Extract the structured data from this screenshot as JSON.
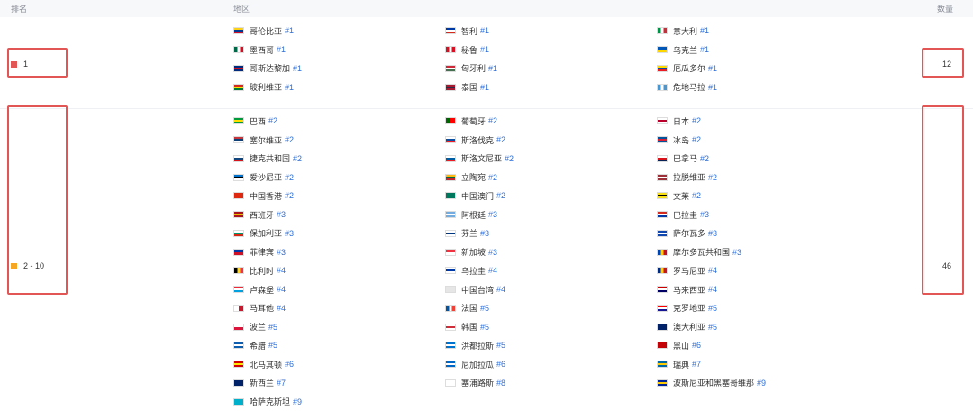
{
  "header": {
    "rank": "排名",
    "region": "地区",
    "count": "数量"
  },
  "groups": [
    {
      "rank": "1",
      "count": "12",
      "color": "#e25656",
      "regions": [
        {
          "name": "哥伦比亚",
          "num": "#1",
          "flag": [
            "#fcd116",
            "#003893",
            "#ce1126"
          ]
        },
        {
          "name": "智利",
          "num": "#1",
          "flag": [
            "#0039a6",
            "#ffffff",
            "#d52b1e"
          ]
        },
        {
          "name": "意大利",
          "num": "#1",
          "flag": [
            "#009246",
            "#ffffff",
            "#ce2b37"
          ],
          "vertical": true
        },
        {
          "name": "墨西哥",
          "num": "#1",
          "flag": [
            "#006847",
            "#ffffff",
            "#ce1126"
          ],
          "vertical": true
        },
        {
          "name": "秘鲁",
          "num": "#1",
          "flag": [
            "#d91023",
            "#ffffff",
            "#d91023"
          ],
          "vertical": true
        },
        {
          "name": "乌克兰",
          "num": "#1",
          "flag": [
            "#0057b7",
            "#ffd700"
          ]
        },
        {
          "name": "哥斯达黎加",
          "num": "#1",
          "flag": [
            "#002b7f",
            "#ce1126",
            "#002b7f"
          ]
        },
        {
          "name": "匈牙利",
          "num": "#1",
          "flag": [
            "#ce2939",
            "#ffffff",
            "#477050"
          ]
        },
        {
          "name": "厄瓜多尔",
          "num": "#1",
          "flag": [
            "#ffdd00",
            "#034ea2",
            "#ed1c24"
          ]
        },
        {
          "name": "玻利维亚",
          "num": "#1",
          "flag": [
            "#d52b1e",
            "#f9e300",
            "#007934"
          ]
        },
        {
          "name": "泰国",
          "num": "#1",
          "flag": [
            "#a51931",
            "#2d2a4a",
            "#a51931"
          ]
        },
        {
          "name": "危地马拉",
          "num": "#1",
          "flag": [
            "#4997d0",
            "#ffffff",
            "#4997d0"
          ],
          "vertical": true
        }
      ]
    },
    {
      "rank": "2 - 10",
      "count": "46",
      "color": "#f5a623",
      "regions": [
        {
          "name": "巴西",
          "num": "#2",
          "flag": [
            "#009c3b",
            "#ffdf00",
            "#009c3b"
          ]
        },
        {
          "name": "葡萄牙",
          "num": "#2",
          "flag": [
            "#006600",
            "#ff0000"
          ],
          "vertical": true
        },
        {
          "name": "日本",
          "num": "#2",
          "flag": [
            "#ffffff",
            "#bc002d",
            "#ffffff"
          ]
        },
        {
          "name": "塞尔维亚",
          "num": "#2",
          "flag": [
            "#c6363c",
            "#0c4076",
            "#ffffff"
          ]
        },
        {
          "name": "斯洛伐克",
          "num": "#2",
          "flag": [
            "#ffffff",
            "#0b4ea2",
            "#ee1c25"
          ]
        },
        {
          "name": "冰岛",
          "num": "#2",
          "flag": [
            "#02529c",
            "#dc1e35",
            "#02529c"
          ]
        },
        {
          "name": "捷克共和国",
          "num": "#2",
          "flag": [
            "#ffffff",
            "#11457e",
            "#d7141a"
          ]
        },
        {
          "name": "斯洛文尼亚",
          "num": "#2",
          "flag": [
            "#ffffff",
            "#005da4",
            "#ed1c24"
          ]
        },
        {
          "name": "巴拿马",
          "num": "#2",
          "flag": [
            "#ffffff",
            "#da121a",
            "#072357"
          ]
        },
        {
          "name": "爱沙尼亚",
          "num": "#2",
          "flag": [
            "#0072ce",
            "#000000",
            "#ffffff"
          ]
        },
        {
          "name": "立陶宛",
          "num": "#2",
          "flag": [
            "#fdb913",
            "#006a44",
            "#c1272d"
          ]
        },
        {
          "name": "拉脱维亚",
          "num": "#2",
          "flag": [
            "#9e3039",
            "#ffffff",
            "#9e3039"
          ]
        },
        {
          "name": "中国香港",
          "num": "#2",
          "flag": [
            "#de2910",
            "#de2910",
            "#de2910"
          ]
        },
        {
          "name": "中国澳门",
          "num": "#2",
          "flag": [
            "#00785e",
            "#00785e",
            "#00785e"
          ]
        },
        {
          "name": "文莱",
          "num": "#2",
          "flag": [
            "#f7e017",
            "#000000",
            "#f7e017"
          ]
        },
        {
          "name": "西班牙",
          "num": "#3",
          "flag": [
            "#aa151b",
            "#f1bf00",
            "#aa151b"
          ]
        },
        {
          "name": "阿根廷",
          "num": "#3",
          "flag": [
            "#74acdf",
            "#ffffff",
            "#74acdf"
          ]
        },
        {
          "name": "巴拉圭",
          "num": "#3",
          "flag": [
            "#d52b1e",
            "#ffffff",
            "#0038a8"
          ]
        },
        {
          "name": "保加利亚",
          "num": "#3",
          "flag": [
            "#ffffff",
            "#00966e",
            "#d62612"
          ]
        },
        {
          "name": "芬兰",
          "num": "#3",
          "flag": [
            "#ffffff",
            "#003580",
            "#ffffff"
          ]
        },
        {
          "name": "萨尔瓦多",
          "num": "#3",
          "flag": [
            "#0f47af",
            "#ffffff",
            "#0f47af"
          ]
        },
        {
          "name": "菲律宾",
          "num": "#3",
          "flag": [
            "#0038a8",
            "#ce1126"
          ]
        },
        {
          "name": "新加坡",
          "num": "#3",
          "flag": [
            "#ef3340",
            "#ffffff"
          ]
        },
        {
          "name": "摩尔多瓦共和国",
          "num": "#3",
          "flag": [
            "#0046ae",
            "#ffd200",
            "#cc092f"
          ],
          "vertical": true
        },
        {
          "name": "比利时",
          "num": "#4",
          "flag": [
            "#000000",
            "#fdda24",
            "#ef3340"
          ],
          "vertical": true
        },
        {
          "name": "乌拉圭",
          "num": "#4",
          "flag": [
            "#ffffff",
            "#0038a8",
            "#ffffff"
          ]
        },
        {
          "name": "罗马尼亚",
          "num": "#4",
          "flag": [
            "#002b7f",
            "#fcd116",
            "#ce1126"
          ],
          "vertical": true
        },
        {
          "name": "卢森堡",
          "num": "#4",
          "flag": [
            "#ed2939",
            "#ffffff",
            "#00a1de"
          ]
        },
        {
          "name": "中国台湾",
          "num": "#4",
          "flag": [
            "#e6e6e6",
            "#e6e6e6",
            "#e6e6e6"
          ]
        },
        {
          "name": "马来西亚",
          "num": "#4",
          "flag": [
            "#cc0001",
            "#ffffff",
            "#010066"
          ]
        },
        {
          "name": "马耳他",
          "num": "#4",
          "flag": [
            "#ffffff",
            "#cf142b"
          ],
          "vertical": true
        },
        {
          "name": "法国",
          "num": "#5",
          "flag": [
            "#0055a4",
            "#ffffff",
            "#ef4135"
          ],
          "vertical": true
        },
        {
          "name": "克罗地亚",
          "num": "#5",
          "flag": [
            "#ff0000",
            "#ffffff",
            "#171796"
          ]
        },
        {
          "name": "波兰",
          "num": "#5",
          "flag": [
            "#ffffff",
            "#dc143c"
          ]
        },
        {
          "name": "韩国",
          "num": "#5",
          "flag": [
            "#ffffff",
            "#cd2e3a",
            "#ffffff"
          ]
        },
        {
          "name": "澳大利亚",
          "num": "#5",
          "flag": [
            "#012169",
            "#012169",
            "#012169"
          ]
        },
        {
          "name": "希腊",
          "num": "#5",
          "flag": [
            "#0d5eaf",
            "#ffffff",
            "#0d5eaf"
          ]
        },
        {
          "name": "洪都拉斯",
          "num": "#5",
          "flag": [
            "#0073cf",
            "#ffffff",
            "#0073cf"
          ]
        },
        {
          "name": "黑山",
          "num": "#6",
          "flag": [
            "#c40308",
            "#c40308",
            "#c40308"
          ]
        },
        {
          "name": "北马其顿",
          "num": "#6",
          "flag": [
            "#d20000",
            "#ffe600",
            "#d20000"
          ]
        },
        {
          "name": "尼加拉瓜",
          "num": "#6",
          "flag": [
            "#0067c6",
            "#ffffff",
            "#0067c6"
          ]
        },
        {
          "name": "瑞典",
          "num": "#7",
          "flag": [
            "#006aa7",
            "#fecc00",
            "#006aa7"
          ]
        },
        {
          "name": "新西兰",
          "num": "#7",
          "flag": [
            "#012169",
            "#012169",
            "#012169"
          ]
        },
        {
          "name": "塞浦路斯",
          "num": "#8",
          "flag": [
            "#ffffff",
            "#ffffff",
            "#ffffff"
          ]
        },
        {
          "name": "波斯尼亚和黑塞哥维那",
          "num": "#9",
          "flag": [
            "#002395",
            "#fecb00",
            "#002395"
          ]
        },
        {
          "name": "哈萨克斯坦",
          "num": "#9",
          "flag": [
            "#00afca",
            "#00afca",
            "#00afca"
          ]
        }
      ]
    }
  ]
}
